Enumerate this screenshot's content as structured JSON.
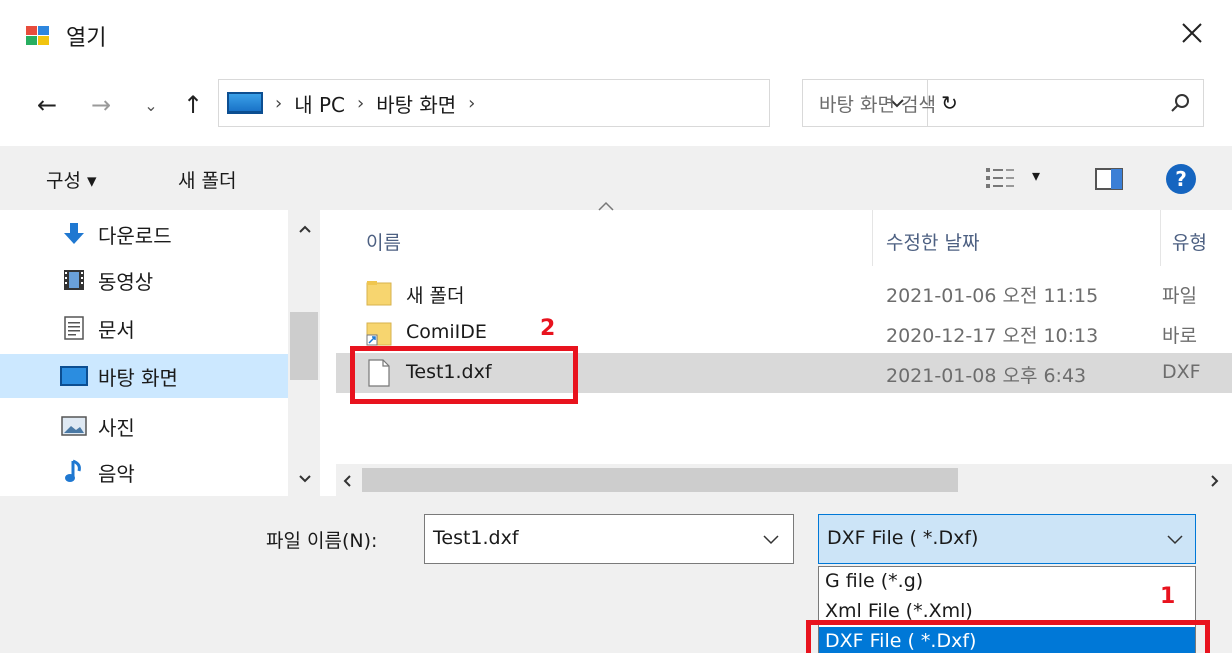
{
  "window": {
    "title": "열기",
    "close_label": "✕"
  },
  "nav": {
    "back": "←",
    "forward": "→",
    "recent": "⌄",
    "up": "↑",
    "breadcrumb": [
      "내 PC",
      "바탕 화면"
    ],
    "refresh": "↻",
    "search_placeholder": "바탕 화면 검색"
  },
  "toolbar": {
    "organize": "구성 ▾",
    "new_folder": "새 폴더",
    "view": "▾",
    "help": "?"
  },
  "sidebar": {
    "items": [
      {
        "label": "다운로드",
        "icon": "download-icon"
      },
      {
        "label": "동영상",
        "icon": "video-icon"
      },
      {
        "label": "문서",
        "icon": "document-icon"
      },
      {
        "label": "바탕 화면",
        "icon": "desktop-icon",
        "selected": true
      },
      {
        "label": "사진",
        "icon": "picture-icon"
      },
      {
        "label": "음악",
        "icon": "music-icon"
      }
    ]
  },
  "columns": {
    "name": "이름",
    "date": "수정한 날짜",
    "type": "유형"
  },
  "files": [
    {
      "name": "새 폴더",
      "date": "2021-01-06 오전 11:15",
      "type": "파일",
      "icon": "folder-icon"
    },
    {
      "name": "ComiIDE",
      "date": "2020-12-17 오전 10:13",
      "type": "바로",
      "icon": "shortcut-folder-icon"
    },
    {
      "name": "Test1.dxf",
      "date": "2021-01-08 오후 6:43",
      "type": "DXF",
      "icon": "file-icon",
      "selected": true
    }
  ],
  "bottom": {
    "filename_label": "파일 이름(N):",
    "filename_value": "Test1.dxf",
    "filetype_value": "DXF File  ( *.Dxf)",
    "filetype_options": [
      "G file (*.g)",
      "Xml File  (*.Xml)",
      "DXF File  ( *.Dxf)"
    ]
  },
  "annotations": {
    "label1": "1",
    "label2": "2",
    "color": "#e8131e"
  }
}
